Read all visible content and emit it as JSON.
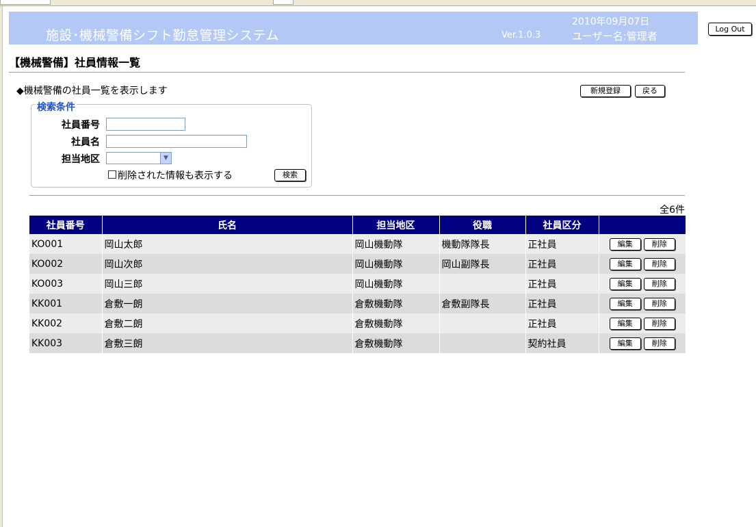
{
  "header": {
    "title": "施設･機械警備シフト勤怠管理システム",
    "version": "Ver.1.0.3",
    "date": "2010年09月07日",
    "user": "ユーザー名:管理者",
    "logout_label": "Log Out"
  },
  "page": {
    "title": "【機械警備】社員情報一覧",
    "description": "◆機械警備の社員一覧を表示します",
    "new_label": "新規登録",
    "back_label": "戻る"
  },
  "search": {
    "legend": "検索条件",
    "employee_no_label": "社員番号",
    "employee_no_value": "",
    "name_label": "社員名",
    "name_value": "",
    "area_label": "担当地区",
    "area_value": "",
    "show_deleted_label": "削除された情報も表示する",
    "show_deleted_checked": false,
    "search_label": "検索"
  },
  "results": {
    "count_text": "全6件",
    "columns": [
      "社員番号",
      "氏名",
      "担当地区",
      "役職",
      "社員区分",
      ""
    ],
    "edit_label": "編集",
    "delete_label": "削除",
    "rows": [
      {
        "id": "KO001",
        "name": "岡山太郎",
        "area": "岡山機動隊",
        "position": "機動隊隊長",
        "type": "正社員"
      },
      {
        "id": "KO002",
        "name": "岡山次郎",
        "area": "岡山機動隊",
        "position": "岡山副隊長",
        "type": "正社員"
      },
      {
        "id": "KO003",
        "name": "岡山三郎",
        "area": "岡山機動隊",
        "position": "",
        "type": "正社員"
      },
      {
        "id": "KK001",
        "name": "倉敷一朗",
        "area": "倉敷機動隊",
        "position": "倉敷副隊長",
        "type": "正社員"
      },
      {
        "id": "KK002",
        "name": "倉敷二朗",
        "area": "倉敷機動隊",
        "position": "",
        "type": "正社員"
      },
      {
        "id": "KK003",
        "name": "倉敷三朗",
        "area": "倉敷機動隊",
        "position": "",
        "type": "契約社員"
      }
    ]
  },
  "colors": {
    "header_bg": "#b4c8f5",
    "table_header_bg": "#000080",
    "legend_text": "#1e50c8",
    "row_light": "#ececec",
    "row_dark": "#dcdcdc"
  }
}
